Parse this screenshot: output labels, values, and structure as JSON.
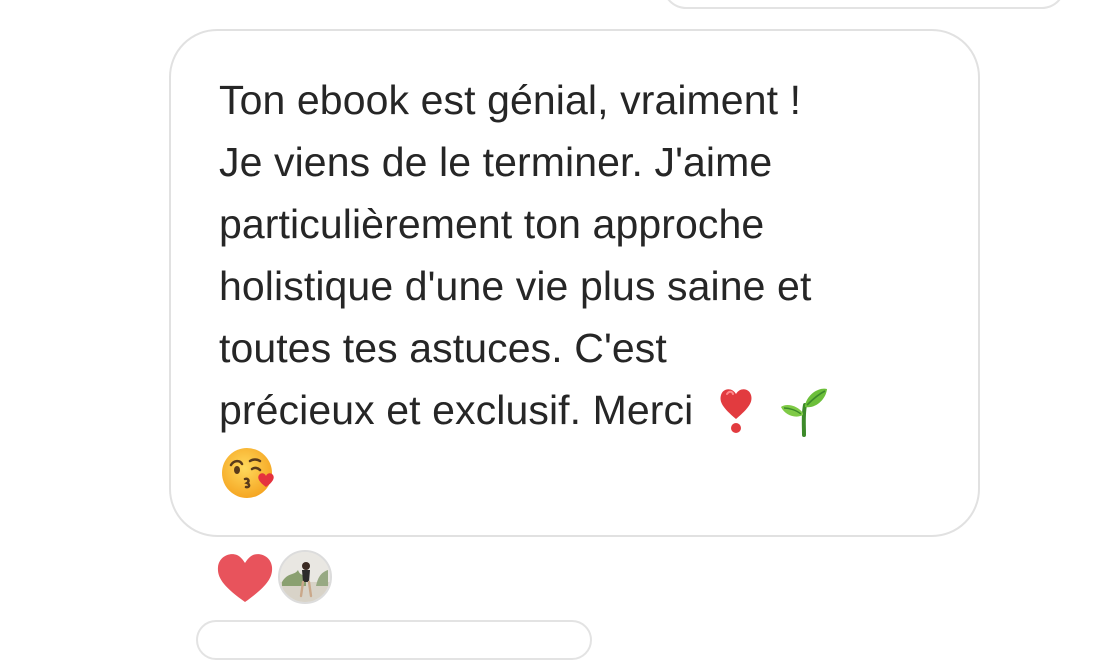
{
  "message": {
    "lines": [
      "Ton ebook est génial, vraiment !",
      "Je viens de le terminer. J'aime",
      "particulièrement ton approche",
      "holistique d'une vie plus saine et",
      "toutes tes astuces. C'est",
      "précieux et exclusif. Merci"
    ],
    "trailing_emojis": [
      "heavy-exclamation-heart-icon",
      "seedling-icon",
      "face-blowing-kiss-icon"
    ]
  },
  "reactions": {
    "items": [
      "red-heart-icon"
    ],
    "reactor_avatar": "profile-photo"
  },
  "colors": {
    "bubble_border": "#e1e1e1",
    "text": "#262626",
    "heart": "#e8535c"
  }
}
